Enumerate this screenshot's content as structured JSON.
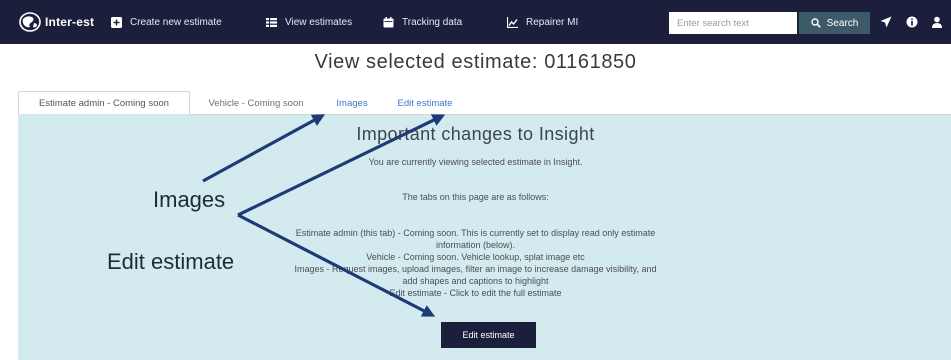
{
  "navbar": {
    "brand": "Inter-est",
    "items": [
      {
        "label": "Create new estimate",
        "icon": "plus-square-icon"
      },
      {
        "label": "View estimates",
        "icon": "list-icon"
      },
      {
        "label": "Tracking data",
        "icon": "calendar-icon"
      },
      {
        "label": "Repairer MI",
        "icon": "line-chart-icon"
      }
    ],
    "search": {
      "placeholder": "Enter search text",
      "button_label": "Search"
    },
    "tool_icons": [
      "send-icon",
      "info-icon",
      "user-icon"
    ]
  },
  "page": {
    "title": "View selected estimate: 01161850"
  },
  "tabs": [
    {
      "label": "Estimate admin - Coming soon",
      "active": true
    },
    {
      "label": "Vehicle - Coming soon",
      "active": false
    },
    {
      "label": "Images",
      "active": false
    },
    {
      "label": "Edit estimate",
      "active": false
    }
  ],
  "panel": {
    "heading": "Important changes to Insight",
    "intro": "You are currently viewing selected estimate in Insight.",
    "tabs_intro": "The tabs on this page are as follows:",
    "lines": [
      "Estimate admin (this tab) - Coming soon. This is currently set to display read only estimate",
      "information (below).",
      "Vehicle - Coming soon. Vehicle lookup, splat image etc",
      "Images - Request images, upload images, filter an image to increase damage visibility, and",
      "add shapes and captions to highlight",
      "Edit estimate - Click to edit the full estimate"
    ],
    "button_label": "Edit estimate"
  },
  "annotations": {
    "images_label": "Images",
    "edit_label": "Edit estimate"
  },
  "colors": {
    "navbar": "#1b1f3b",
    "panel": "#d3eaee",
    "search_button": "#3c5a6a",
    "link": "#3d78c8",
    "arrow": "#1e3a78"
  }
}
